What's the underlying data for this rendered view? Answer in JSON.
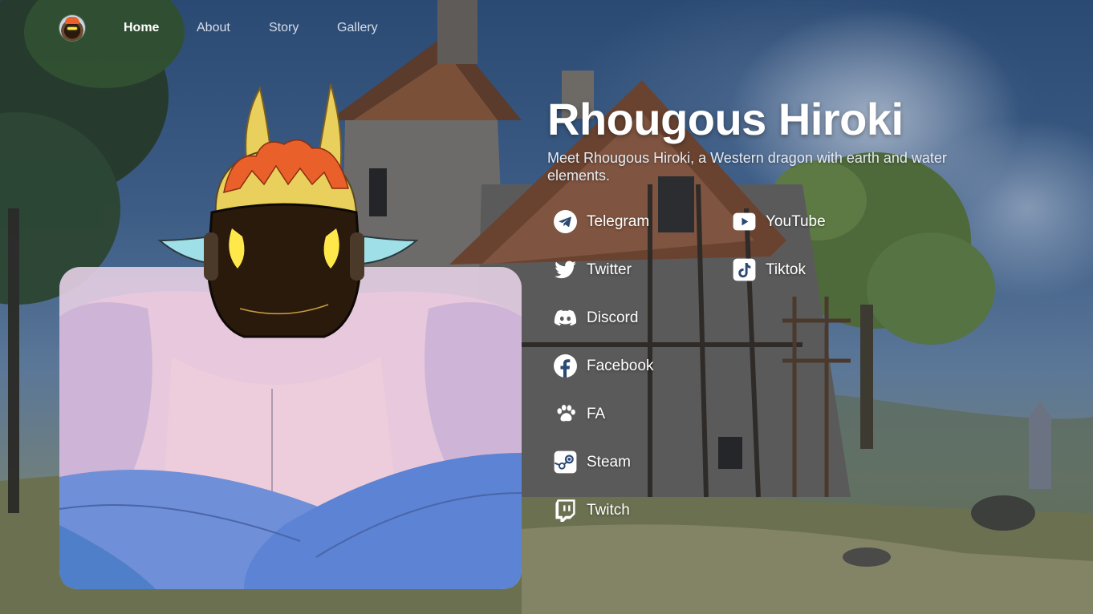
{
  "nav": {
    "logo_alt": "Rhougous Hiroki avatar",
    "links": [
      {
        "label": "Home",
        "active": true
      },
      {
        "label": "About",
        "active": false
      },
      {
        "label": "Story",
        "active": false
      },
      {
        "label": "Gallery",
        "active": false
      }
    ]
  },
  "hero": {
    "title": "Rhougous Hiroki",
    "subtitle": "Meet Rhougous Hiroki, a Western dragon with earth and water elements."
  },
  "socials": {
    "left": [
      {
        "label": "Telegram",
        "icon": "telegram-icon"
      },
      {
        "label": "Twitter",
        "icon": "twitter-icon"
      },
      {
        "label": "Discord",
        "icon": "discord-icon"
      },
      {
        "label": "Facebook",
        "icon": "facebook-icon"
      },
      {
        "label": "FA",
        "icon": "paw-icon"
      },
      {
        "label": "Steam",
        "icon": "steam-icon"
      },
      {
        "label": "Twitch",
        "icon": "twitch-icon"
      }
    ],
    "right": [
      {
        "label": "YouTube",
        "icon": "youtube-icon"
      },
      {
        "label": "Tiktok",
        "icon": "tiktok-icon"
      }
    ]
  },
  "colors": {
    "sky": "#2b4a73",
    "card_bg": "#e2cde2",
    "text": "#ffffff",
    "horns": "#e9cf5b",
    "hair": "#e9602a",
    "eyes": "#ffe94a",
    "skin_blue": "#6aa4dc"
  }
}
